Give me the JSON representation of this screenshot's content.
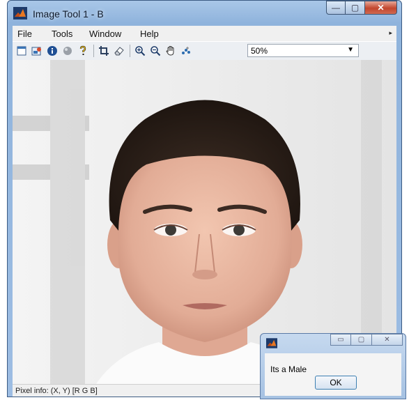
{
  "window": {
    "title": "Image Tool 1 - B",
    "caption": {
      "minimize": "—",
      "maximize": "▢",
      "close": "✕"
    }
  },
  "menu": {
    "items": [
      "File",
      "Tools",
      "Window",
      "Help"
    ],
    "overflow": "▸"
  },
  "toolbar": {
    "icons": [
      "new-figure-icon",
      "export-icon",
      "info-icon",
      "circle-icon",
      "help-icon",
      "crop-icon",
      "eraser-icon",
      "zoom-in-icon",
      "zoom-out-icon",
      "pan-hand-icon",
      "data-cursor-icon"
    ],
    "zoom": {
      "value": "50%",
      "arrow": "▼"
    }
  },
  "status": {
    "pixel_info": "Pixel info: (X, Y)  [R G B]"
  },
  "dialog": {
    "text": "Its a Male",
    "ok_label": "OK",
    "caption": {
      "minimize": "▭",
      "maximize": "▢",
      "close": "✕"
    }
  },
  "colors": {
    "accent": "#3c7fb1",
    "matlab_orange": "#e87722"
  }
}
